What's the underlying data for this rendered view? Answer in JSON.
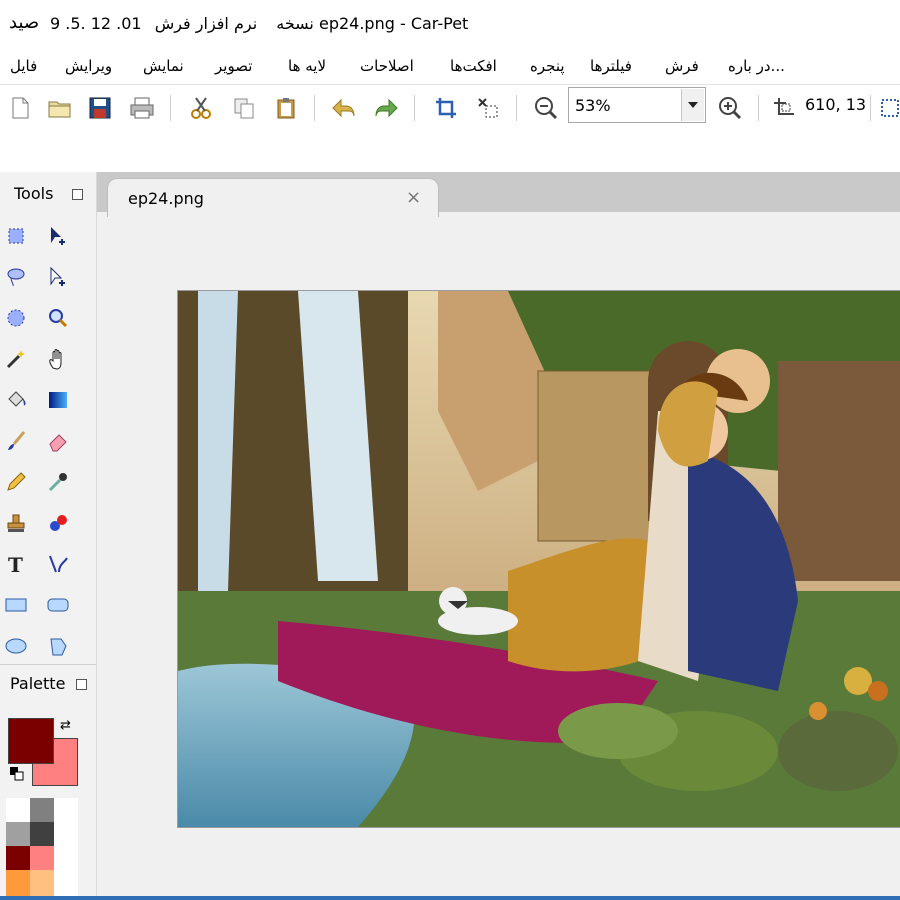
{
  "window": {
    "app_icon_glyph": "ﺻﯿﺪ",
    "title": "نرم افزار فرش  ep24.png - Car-Pet",
    "version_label": "9 .5. 12 .01",
    "version_word": "نسخه"
  },
  "menu": {
    "items": [
      {
        "id": "file",
        "label": "فایل"
      },
      {
        "id": "edit",
        "label": "ویرایش"
      },
      {
        "id": "view",
        "label": "نمایش"
      },
      {
        "id": "image",
        "label": "تصویر"
      },
      {
        "id": "layers",
        "label": "لایه ها"
      },
      {
        "id": "adjust",
        "label": "اصلاحات"
      },
      {
        "id": "effects",
        "label": "افکت‌ها"
      },
      {
        "id": "window",
        "label": "پنجره"
      },
      {
        "id": "filters",
        "label": "فیلترها"
      },
      {
        "id": "carpet",
        "label": "فرش"
      },
      {
        "id": "about",
        "label": "در باره..."
      }
    ]
  },
  "toolbar": {
    "zoom_value": "53%",
    "cursor_coords": "610, 13",
    "icons": [
      "new-file-icon",
      "open-folder-icon",
      "save-icon",
      "print-icon",
      "cut-icon",
      "copy-icon",
      "paste-icon",
      "undo-icon",
      "redo-icon",
      "crop-icon",
      "deselect-icon",
      "zoom-out-icon",
      "zoom-in-icon",
      "cursor-position-icon",
      "grid-icon"
    ]
  },
  "tools_panel": {
    "title": "Tools",
    "tools": [
      "rectangle-select",
      "move-selection",
      "lasso-select",
      "move-selected",
      "ellipse-select",
      "zoom",
      "magic-wand",
      "pan",
      "paint-bucket",
      "gradient",
      "paintbrush",
      "eraser",
      "pencil",
      "color-picker",
      "clone-stamp",
      "recolor",
      "text",
      "line-curve",
      "rectangle",
      "rounded-rectangle",
      "ellipse",
      "freeform-shape"
    ]
  },
  "palette_panel": {
    "title": "Palette",
    "primary_color": "#7a0000",
    "secondary_color": "#ff8080",
    "swatches": [
      "#ffffff",
      "#808080",
      "#ffffff",
      "#a0a0a0",
      "#404040",
      "#ffffff",
      "#7a0000",
      "#ff8080",
      "#ffffff",
      "#ff9a3c",
      "#ffc080",
      "#ffffff"
    ]
  },
  "document": {
    "tab_label": "ep24.png",
    "close_glyph": "×"
  },
  "colors": {
    "accent": "#2f6db5",
    "panel_bg": "#f2f2f2",
    "tab_strip": "#c9c9c9"
  }
}
